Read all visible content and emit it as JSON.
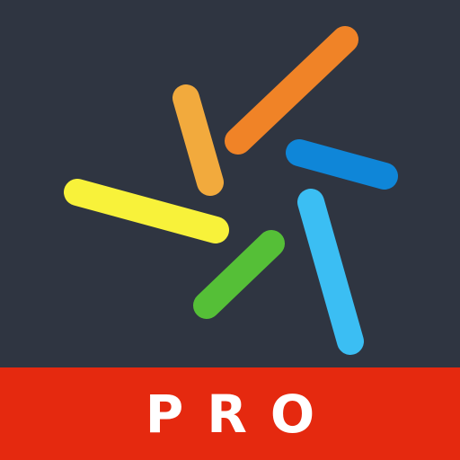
{
  "app": {
    "variant_label": "PRO"
  },
  "colors": {
    "background": "#2f3541",
    "banner": "#e5290f",
    "stroke_orange": "#f08327",
    "stroke_gold": "#f2aa3d",
    "stroke_blue": "#0f86d8",
    "stroke_yellow": "#f8f23a",
    "stroke_sky": "#3bbef3",
    "stroke_green": "#55bf37"
  },
  "icons": {
    "logo": "burst-strokes-logo-icon"
  }
}
